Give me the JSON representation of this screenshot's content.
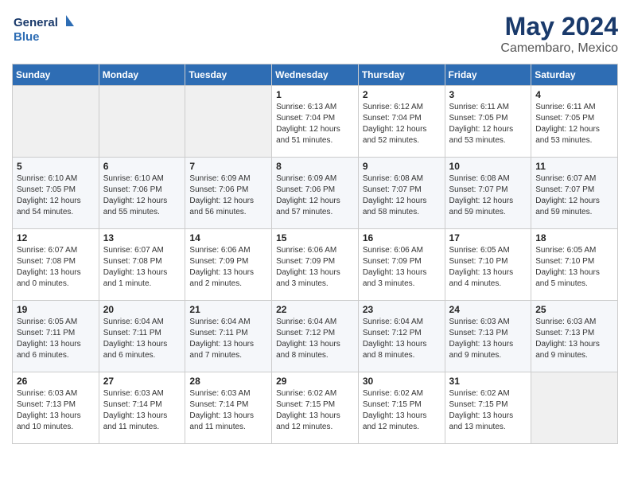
{
  "header": {
    "logo_line1": "General",
    "logo_line2": "Blue",
    "month": "May 2024",
    "location": "Camembaro, Mexico"
  },
  "days_of_week": [
    "Sunday",
    "Monday",
    "Tuesday",
    "Wednesday",
    "Thursday",
    "Friday",
    "Saturday"
  ],
  "weeks": [
    [
      {
        "day": "",
        "sunrise": "",
        "sunset": "",
        "daylight": "",
        "empty": true
      },
      {
        "day": "",
        "sunrise": "",
        "sunset": "",
        "daylight": "",
        "empty": true
      },
      {
        "day": "",
        "sunrise": "",
        "sunset": "",
        "daylight": "",
        "empty": true
      },
      {
        "day": "1",
        "sunrise": "Sunrise: 6:13 AM",
        "sunset": "Sunset: 7:04 PM",
        "daylight": "Daylight: 12 hours and 51 minutes."
      },
      {
        "day": "2",
        "sunrise": "Sunrise: 6:12 AM",
        "sunset": "Sunset: 7:04 PM",
        "daylight": "Daylight: 12 hours and 52 minutes."
      },
      {
        "day": "3",
        "sunrise": "Sunrise: 6:11 AM",
        "sunset": "Sunset: 7:05 PM",
        "daylight": "Daylight: 12 hours and 53 minutes."
      },
      {
        "day": "4",
        "sunrise": "Sunrise: 6:11 AM",
        "sunset": "Sunset: 7:05 PM",
        "daylight": "Daylight: 12 hours and 53 minutes."
      }
    ],
    [
      {
        "day": "5",
        "sunrise": "Sunrise: 6:10 AM",
        "sunset": "Sunset: 7:05 PM",
        "daylight": "Daylight: 12 hours and 54 minutes."
      },
      {
        "day": "6",
        "sunrise": "Sunrise: 6:10 AM",
        "sunset": "Sunset: 7:06 PM",
        "daylight": "Daylight: 12 hours and 55 minutes."
      },
      {
        "day": "7",
        "sunrise": "Sunrise: 6:09 AM",
        "sunset": "Sunset: 7:06 PM",
        "daylight": "Daylight: 12 hours and 56 minutes."
      },
      {
        "day": "8",
        "sunrise": "Sunrise: 6:09 AM",
        "sunset": "Sunset: 7:06 PM",
        "daylight": "Daylight: 12 hours and 57 minutes."
      },
      {
        "day": "9",
        "sunrise": "Sunrise: 6:08 AM",
        "sunset": "Sunset: 7:07 PM",
        "daylight": "Daylight: 12 hours and 58 minutes."
      },
      {
        "day": "10",
        "sunrise": "Sunrise: 6:08 AM",
        "sunset": "Sunset: 7:07 PM",
        "daylight": "Daylight: 12 hours and 59 minutes."
      },
      {
        "day": "11",
        "sunrise": "Sunrise: 6:07 AM",
        "sunset": "Sunset: 7:07 PM",
        "daylight": "Daylight: 12 hours and 59 minutes."
      }
    ],
    [
      {
        "day": "12",
        "sunrise": "Sunrise: 6:07 AM",
        "sunset": "Sunset: 7:08 PM",
        "daylight": "Daylight: 13 hours and 0 minutes."
      },
      {
        "day": "13",
        "sunrise": "Sunrise: 6:07 AM",
        "sunset": "Sunset: 7:08 PM",
        "daylight": "Daylight: 13 hours and 1 minute."
      },
      {
        "day": "14",
        "sunrise": "Sunrise: 6:06 AM",
        "sunset": "Sunset: 7:09 PM",
        "daylight": "Daylight: 13 hours and 2 minutes."
      },
      {
        "day": "15",
        "sunrise": "Sunrise: 6:06 AM",
        "sunset": "Sunset: 7:09 PM",
        "daylight": "Daylight: 13 hours and 3 minutes."
      },
      {
        "day": "16",
        "sunrise": "Sunrise: 6:06 AM",
        "sunset": "Sunset: 7:09 PM",
        "daylight": "Daylight: 13 hours and 3 minutes."
      },
      {
        "day": "17",
        "sunrise": "Sunrise: 6:05 AM",
        "sunset": "Sunset: 7:10 PM",
        "daylight": "Daylight: 13 hours and 4 minutes."
      },
      {
        "day": "18",
        "sunrise": "Sunrise: 6:05 AM",
        "sunset": "Sunset: 7:10 PM",
        "daylight": "Daylight: 13 hours and 5 minutes."
      }
    ],
    [
      {
        "day": "19",
        "sunrise": "Sunrise: 6:05 AM",
        "sunset": "Sunset: 7:11 PM",
        "daylight": "Daylight: 13 hours and 6 minutes."
      },
      {
        "day": "20",
        "sunrise": "Sunrise: 6:04 AM",
        "sunset": "Sunset: 7:11 PM",
        "daylight": "Daylight: 13 hours and 6 minutes."
      },
      {
        "day": "21",
        "sunrise": "Sunrise: 6:04 AM",
        "sunset": "Sunset: 7:11 PM",
        "daylight": "Daylight: 13 hours and 7 minutes."
      },
      {
        "day": "22",
        "sunrise": "Sunrise: 6:04 AM",
        "sunset": "Sunset: 7:12 PM",
        "daylight": "Daylight: 13 hours and 8 minutes."
      },
      {
        "day": "23",
        "sunrise": "Sunrise: 6:04 AM",
        "sunset": "Sunset: 7:12 PM",
        "daylight": "Daylight: 13 hours and 8 minutes."
      },
      {
        "day": "24",
        "sunrise": "Sunrise: 6:03 AM",
        "sunset": "Sunset: 7:13 PM",
        "daylight": "Daylight: 13 hours and 9 minutes."
      },
      {
        "day": "25",
        "sunrise": "Sunrise: 6:03 AM",
        "sunset": "Sunset: 7:13 PM",
        "daylight": "Daylight: 13 hours and 9 minutes."
      }
    ],
    [
      {
        "day": "26",
        "sunrise": "Sunrise: 6:03 AM",
        "sunset": "Sunset: 7:13 PM",
        "daylight": "Daylight: 13 hours and 10 minutes."
      },
      {
        "day": "27",
        "sunrise": "Sunrise: 6:03 AM",
        "sunset": "Sunset: 7:14 PM",
        "daylight": "Daylight: 13 hours and 11 minutes."
      },
      {
        "day": "28",
        "sunrise": "Sunrise: 6:03 AM",
        "sunset": "Sunset: 7:14 PM",
        "daylight": "Daylight: 13 hours and 11 minutes."
      },
      {
        "day": "29",
        "sunrise": "Sunrise: 6:02 AM",
        "sunset": "Sunset: 7:15 PM",
        "daylight": "Daylight: 13 hours and 12 minutes."
      },
      {
        "day": "30",
        "sunrise": "Sunrise: 6:02 AM",
        "sunset": "Sunset: 7:15 PM",
        "daylight": "Daylight: 13 hours and 12 minutes."
      },
      {
        "day": "31",
        "sunrise": "Sunrise: 6:02 AM",
        "sunset": "Sunset: 7:15 PM",
        "daylight": "Daylight: 13 hours and 13 minutes."
      },
      {
        "day": "",
        "sunrise": "",
        "sunset": "",
        "daylight": "",
        "empty": true
      }
    ]
  ]
}
